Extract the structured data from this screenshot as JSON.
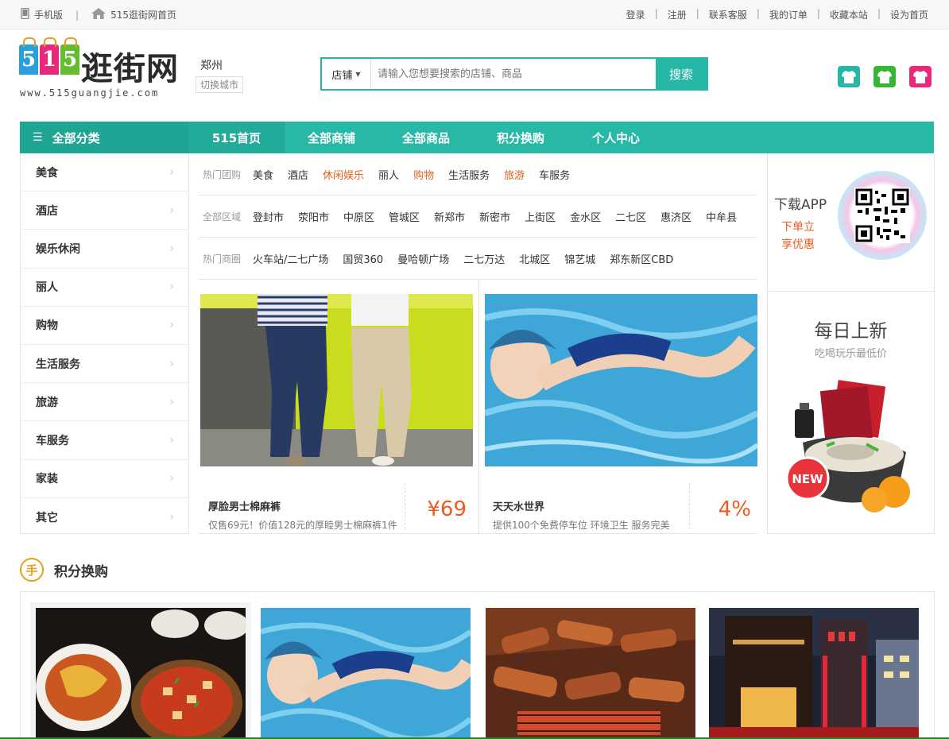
{
  "topbar": {
    "mobile": "手机版",
    "home": "515逛街网首页",
    "links": [
      "登录",
      "注册",
      "联系客服",
      "我的订单",
      "收藏本站",
      "设为首页"
    ]
  },
  "logo": {
    "digits": [
      "5",
      "1",
      "5"
    ],
    "name": "逛街网",
    "url": "www.515guangjie.com"
  },
  "city": {
    "name": "郑州",
    "switch": "切换城市"
  },
  "search": {
    "scope": "店铺",
    "placeholder": "请输入您想要搜索的店铺、商品",
    "button": "搜索"
  },
  "tee_colors": [
    "#26b7a6",
    "#34b833",
    "#e8287a"
  ],
  "nav": {
    "all": "全部分类",
    "items": [
      "515首页",
      "全部商铺",
      "全部商品",
      "积分换购",
      "个人中心"
    ]
  },
  "categories": [
    "美食",
    "酒店",
    "娱乐休闲",
    "丽人",
    "购物",
    "生活服务",
    "旅游",
    "车服务",
    "家装",
    "其它"
  ],
  "filters": {
    "groups": {
      "label": "热门团购",
      "items": [
        "美食",
        "酒店",
        "休闲娱乐",
        "丽人",
        "购物",
        "生活服务",
        "旅游",
        "车服务"
      ]
    },
    "areas": {
      "label": "全部区域",
      "items": [
        "登封市",
        "荥阳市",
        "中原区",
        "管城区",
        "新郑市",
        "新密市",
        "上街区",
        "金水区",
        "二七区",
        "惠济区",
        "中牟县"
      ]
    },
    "malls": {
      "label": "热门商圈",
      "items": [
        "火车站/二七广场",
        "国贸360",
        "曼哈顿广场",
        "二七万达",
        "北城区",
        "锦艺城",
        "郑东新区CBD"
      ]
    }
  },
  "deals": [
    {
      "title": "厚脸男士棉麻裤",
      "desc": "仅售69元！价值128元的厚睦男士棉麻裤1件",
      "price": "¥69"
    },
    {
      "title": "天天水世界",
      "desc": "提供100个免费停车位 环境卫生 服务完美",
      "price": "4%"
    }
  ],
  "app": {
    "title": "下载APP",
    "line1": "下单立",
    "line2": "享优惠"
  },
  "daily": {
    "title": "每日上新",
    "subtitle": "吃喝玩乐最低价",
    "badge": "NEW"
  },
  "points": {
    "icon_char": "手",
    "title": "积分换购"
  }
}
